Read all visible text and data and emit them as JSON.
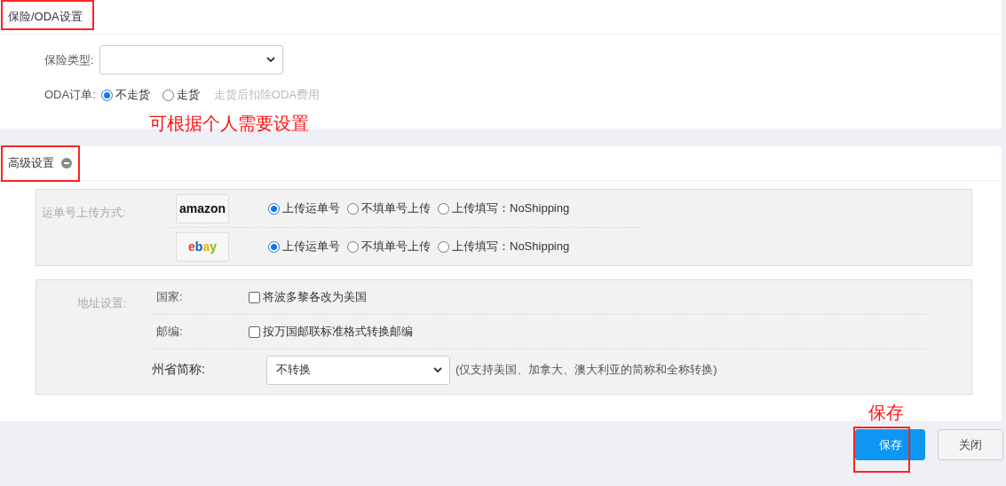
{
  "insurance_section": {
    "title": "保险/ODA设置",
    "insurance_type": {
      "label": "保险类型:"
    },
    "oda_order": {
      "label": "ODA订单:",
      "options": [
        {
          "label": "不走货",
          "selected": true
        },
        {
          "label": "走货",
          "selected": false
        }
      ],
      "hint": "走货后扣除ODA费用"
    }
  },
  "advanced_section": {
    "title": "高级设置",
    "upload_method": {
      "label": "运单号上传方式:",
      "platforms": [
        {
          "logo": "amazon",
          "options": [
            {
              "label": "上传运单号",
              "selected": true
            },
            {
              "label": "不填单号上传",
              "selected": false
            },
            {
              "label": "上传填写：NoShipping",
              "selected": false
            }
          ]
        },
        {
          "logo": "ebay",
          "options": [
            {
              "label": "上传运单号",
              "selected": true
            },
            {
              "label": "不填单号上传",
              "selected": false
            },
            {
              "label": "上传填写：NoShipping",
              "selected": false
            }
          ]
        }
      ]
    },
    "address": {
      "label": "地址设置:",
      "rows": [
        {
          "kind": "checkbox",
          "label": "国家:",
          "option": "将波多黎各改为美国",
          "checked": false
        },
        {
          "kind": "checkbox",
          "label": "邮编:",
          "option": "按万国邮联标准格式转换邮编",
          "checked": false
        },
        {
          "kind": "select",
          "label": "州省简称:",
          "value": "不转换",
          "note": "(仅支持美国、加拿大、澳大利亚的简称和全称转换)"
        }
      ]
    }
  },
  "buttons": [
    {
      "label": "保存",
      "kind": "primary"
    },
    {
      "label": "关闭",
      "kind": "default"
    }
  ],
  "annotations": [
    {
      "text": "可根据个人需要设置"
    },
    {
      "text": "保存"
    }
  ]
}
